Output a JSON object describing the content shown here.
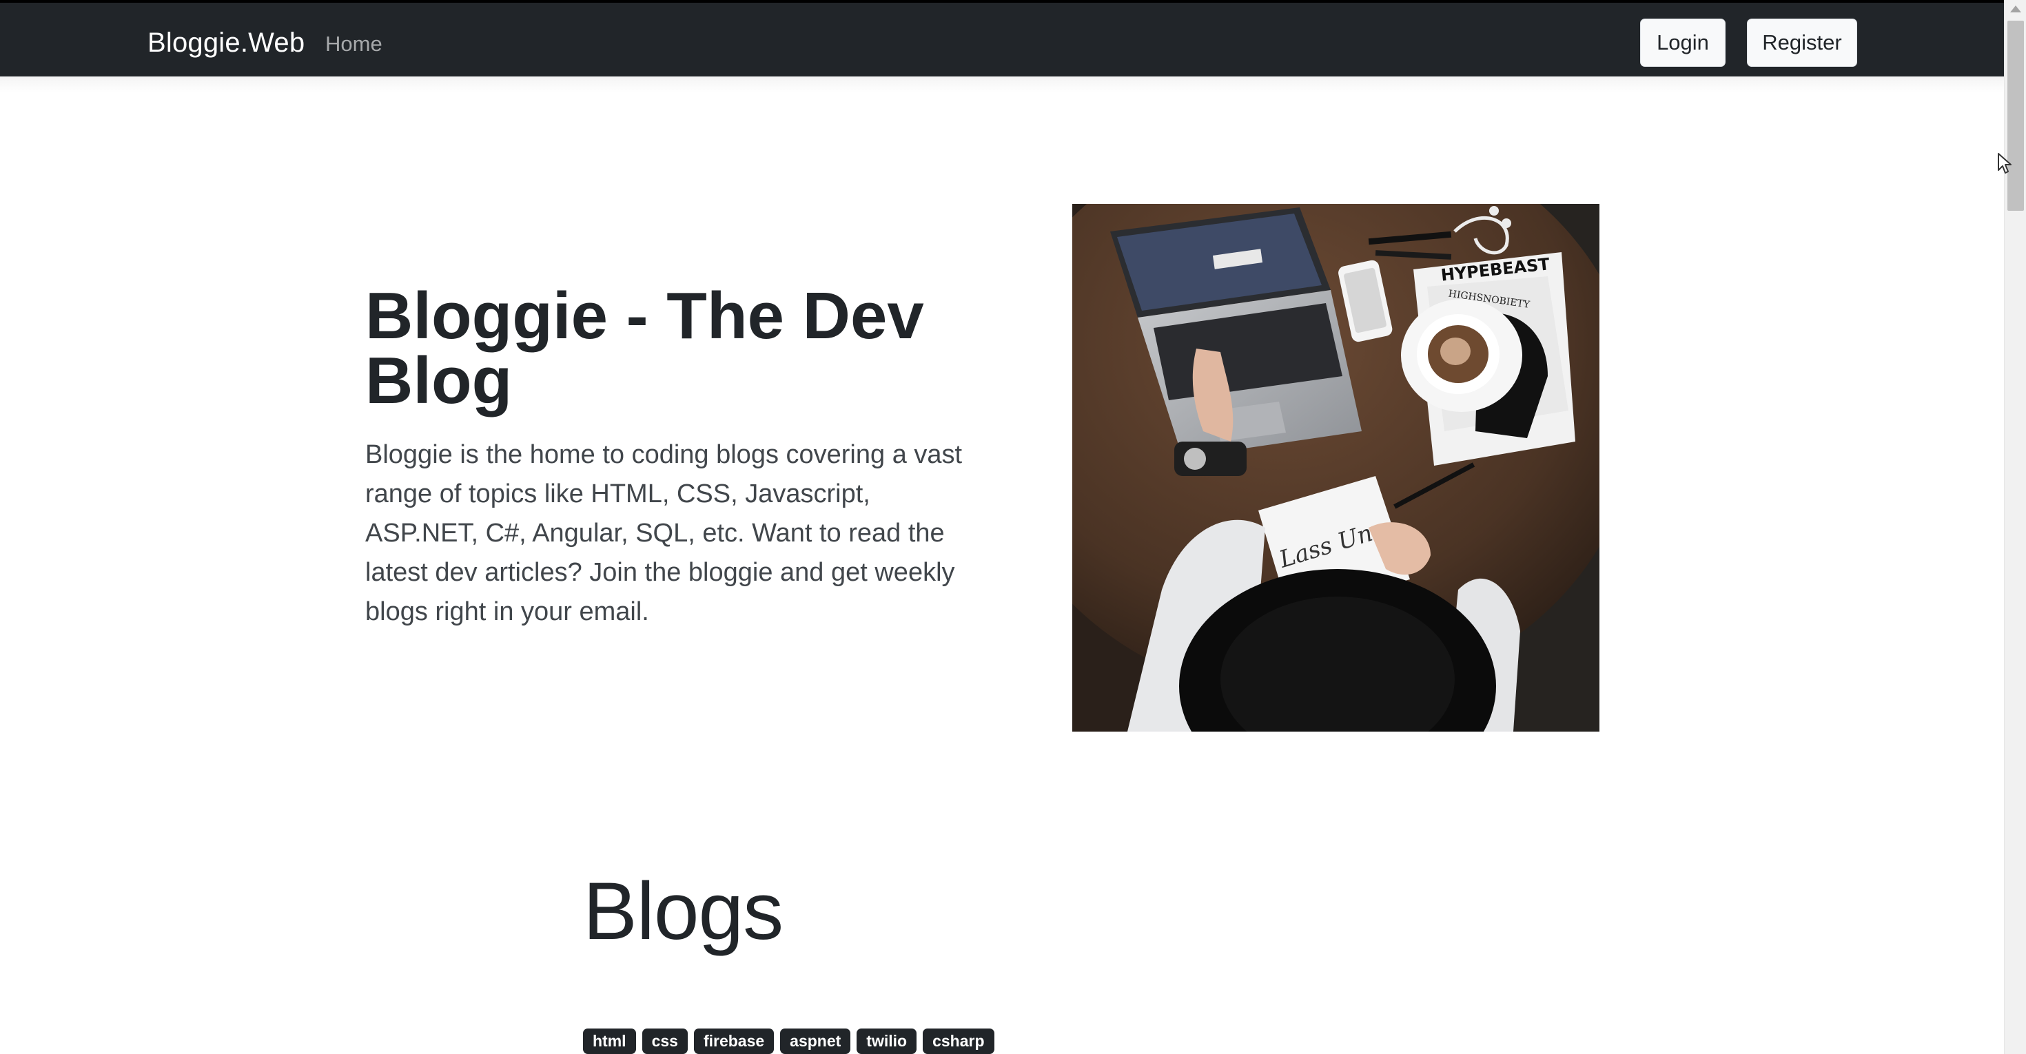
{
  "navbar": {
    "brand": "Bloggie.Web",
    "links": [
      {
        "label": "Home"
      }
    ],
    "buttons": {
      "login": "Login",
      "register": "Register"
    }
  },
  "hero": {
    "title": "Bloggie - The Dev Blog",
    "description": "Bloggie is the home to coding blogs covering a vast range of topics like HTML, CSS, Javascript, ASP.NET, C#, Angular, SQL, etc. Want to read the latest dev articles? Join the bloggie and get weekly blogs right in your email.",
    "image": {
      "magazine_text": "HYPEBEAST",
      "magazine_subtext": "HIGHSNOBIETY",
      "notebook_text": "Lass Uns"
    }
  },
  "blogs": {
    "heading": "Blogs",
    "tags": [
      "html",
      "css",
      "firebase",
      "aspnet",
      "twilio",
      "csharp"
    ]
  },
  "colors": {
    "navbar_bg": "#212529",
    "button_bg": "#f8f9fa",
    "tag_bg": "#212529",
    "page_bg": "#ffffff"
  }
}
